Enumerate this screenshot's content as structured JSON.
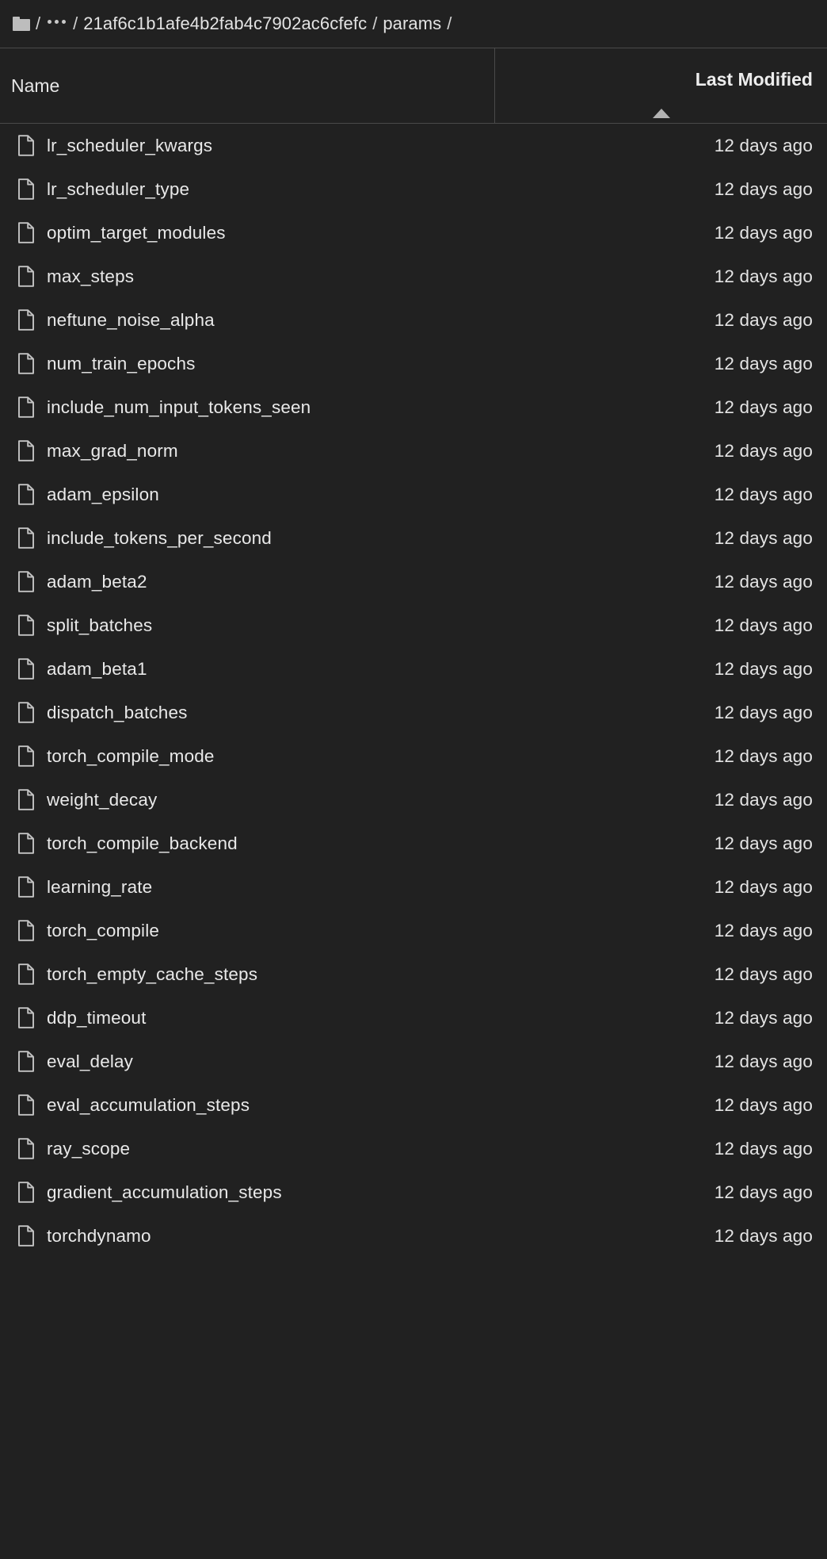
{
  "breadcrumb": {
    "root_icon": "folder-icon",
    "separator": "/",
    "ellipsis": "…",
    "items": [
      "21af6c1b1afe4b2fab4c7902ac6cfefc",
      "params"
    ]
  },
  "table": {
    "columns": {
      "name": "Name",
      "last_modified": "Last Modified"
    },
    "sort": {
      "column": "Last Modified",
      "direction": "ascending",
      "indicator_icon": "caret-up-icon"
    },
    "rows": [
      {
        "icon": "file-icon",
        "name": "lr_scheduler_kwargs",
        "modified": "12 days ago"
      },
      {
        "icon": "file-icon",
        "name": "lr_scheduler_type",
        "modified": "12 days ago"
      },
      {
        "icon": "file-icon",
        "name": "optim_target_modules",
        "modified": "12 days ago"
      },
      {
        "icon": "file-icon",
        "name": "max_steps",
        "modified": "12 days ago"
      },
      {
        "icon": "file-icon",
        "name": "neftune_noise_alpha",
        "modified": "12 days ago"
      },
      {
        "icon": "file-icon",
        "name": "num_train_epochs",
        "modified": "12 days ago"
      },
      {
        "icon": "file-icon",
        "name": "include_num_input_tokens_seen",
        "modified": "12 days ago"
      },
      {
        "icon": "file-icon",
        "name": "max_grad_norm",
        "modified": "12 days ago"
      },
      {
        "icon": "file-icon",
        "name": "adam_epsilon",
        "modified": "12 days ago"
      },
      {
        "icon": "file-icon",
        "name": "include_tokens_per_second",
        "modified": "12 days ago"
      },
      {
        "icon": "file-icon",
        "name": "adam_beta2",
        "modified": "12 days ago"
      },
      {
        "icon": "file-icon",
        "name": "split_batches",
        "modified": "12 days ago"
      },
      {
        "icon": "file-icon",
        "name": "adam_beta1",
        "modified": "12 days ago"
      },
      {
        "icon": "file-icon",
        "name": "dispatch_batches",
        "modified": "12 days ago"
      },
      {
        "icon": "file-icon",
        "name": "torch_compile_mode",
        "modified": "12 days ago"
      },
      {
        "icon": "file-icon",
        "name": "weight_decay",
        "modified": "12 days ago"
      },
      {
        "icon": "file-icon",
        "name": "torch_compile_backend",
        "modified": "12 days ago"
      },
      {
        "icon": "file-icon",
        "name": "learning_rate",
        "modified": "12 days ago"
      },
      {
        "icon": "file-icon",
        "name": "torch_compile",
        "modified": "12 days ago"
      },
      {
        "icon": "file-icon",
        "name": "torch_empty_cache_steps",
        "modified": "12 days ago"
      },
      {
        "icon": "file-icon",
        "name": "ddp_timeout",
        "modified": "12 days ago"
      },
      {
        "icon": "file-icon",
        "name": "eval_delay",
        "modified": "12 days ago"
      },
      {
        "icon": "file-icon",
        "name": "eval_accumulation_steps",
        "modified": "12 days ago"
      },
      {
        "icon": "file-icon",
        "name": "ray_scope",
        "modified": "12 days ago"
      },
      {
        "icon": "file-icon",
        "name": "gradient_accumulation_steps",
        "modified": "12 days ago"
      },
      {
        "icon": "file-icon",
        "name": "torchdynamo",
        "modified": "12 days ago"
      }
    ]
  },
  "colors": {
    "background": "#212121",
    "text": "#e6e6e6",
    "divider": "#4a4a4a",
    "icon": "#bdbdbd"
  }
}
